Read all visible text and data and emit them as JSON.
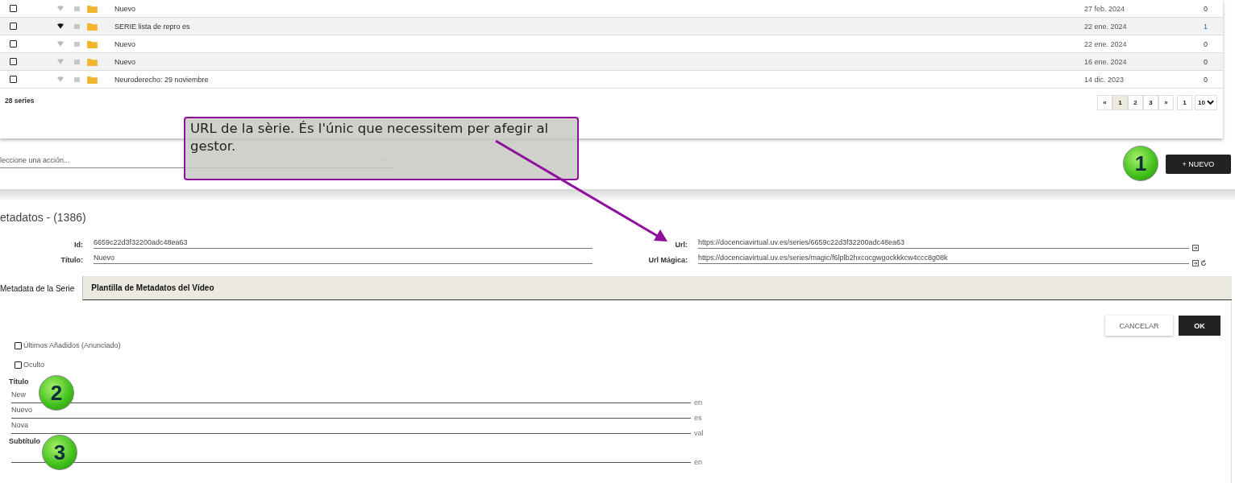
{
  "table": {
    "rows": [
      {
        "checked": false,
        "broadcast": false,
        "title": "Nuevo",
        "date": "27 feb. 2024",
        "count": "0",
        "count_link": false
      },
      {
        "checked": false,
        "broadcast": true,
        "title": "SERIE lista de repro es",
        "date": "22 ene. 2024",
        "count": "1",
        "count_link": true
      },
      {
        "checked": false,
        "broadcast": false,
        "title": "Nuevo",
        "date": "22 ene. 2024",
        "count": "0",
        "count_link": false
      },
      {
        "checked": false,
        "broadcast": false,
        "title": "Nuevo",
        "date": "16 ene. 2024",
        "count": "0",
        "count_link": false
      },
      {
        "checked": false,
        "broadcast": false,
        "title": "Neuroderecho: 29 noviembre",
        "date": "14 dic. 2023",
        "count": "0",
        "count_link": false
      }
    ],
    "total": "28 series",
    "pagination": [
      {
        "label": "«",
        "selected": false
      },
      {
        "label": "1",
        "selected": true
      },
      {
        "label": "2",
        "selected": false
      },
      {
        "label": "3",
        "selected": false
      },
      {
        "label": "»",
        "selected": false
      }
    ],
    "page": "1",
    "page_size": "10"
  },
  "actions": {
    "select_placeholder": "leccione una acción...",
    "new_button": "+ NUEVO"
  },
  "metadata": {
    "title": "etadatos - (1386)",
    "left_fields": [
      {
        "label": "Id:",
        "value": "6659c22d3f32200adc48ea63"
      },
      {
        "label": "Título:",
        "value": "Nuevo"
      }
    ],
    "right_fields": [
      {
        "label": "Url:",
        "value": "https://docenciavirtual.uv.es/series/6659c22d3f32200adc48ea63",
        "refresh": false
      },
      {
        "label": "Url Mágica:",
        "value": "https://docenciavirtual.uv.es/series/magic/f6lplb2hxcocgwgockkkcw4ccc8g08k",
        "refresh": true
      }
    ],
    "tabs": [
      {
        "label": "Metadata de la Serie",
        "selected": true
      },
      {
        "label": "Plantilla de Metadatos del Vídeo",
        "selected": false
      }
    ],
    "cancel_button": "CANCELAR",
    "ok_button": "OK",
    "checkboxes": [
      {
        "label": "Últimos Añadidos (Anunciado)",
        "checked": false
      },
      {
        "label": "Oculto",
        "checked": false
      }
    ],
    "sections": [
      {
        "heading": "Título",
        "entries": [
          {
            "value": "New",
            "lang": "en"
          },
          {
            "value": "Nuevo",
            "lang": "es"
          },
          {
            "value": "Nova",
            "lang": "val"
          }
        ]
      },
      {
        "heading": "Subtítulo",
        "entries": [
          {
            "lang": "en"
          }
        ]
      }
    ]
  },
  "annotations": {
    "callout": "URL de la sèrie. És l'únic que necessitem per afegir al gestor.",
    "badges": [
      "1",
      "2",
      "3"
    ]
  }
}
